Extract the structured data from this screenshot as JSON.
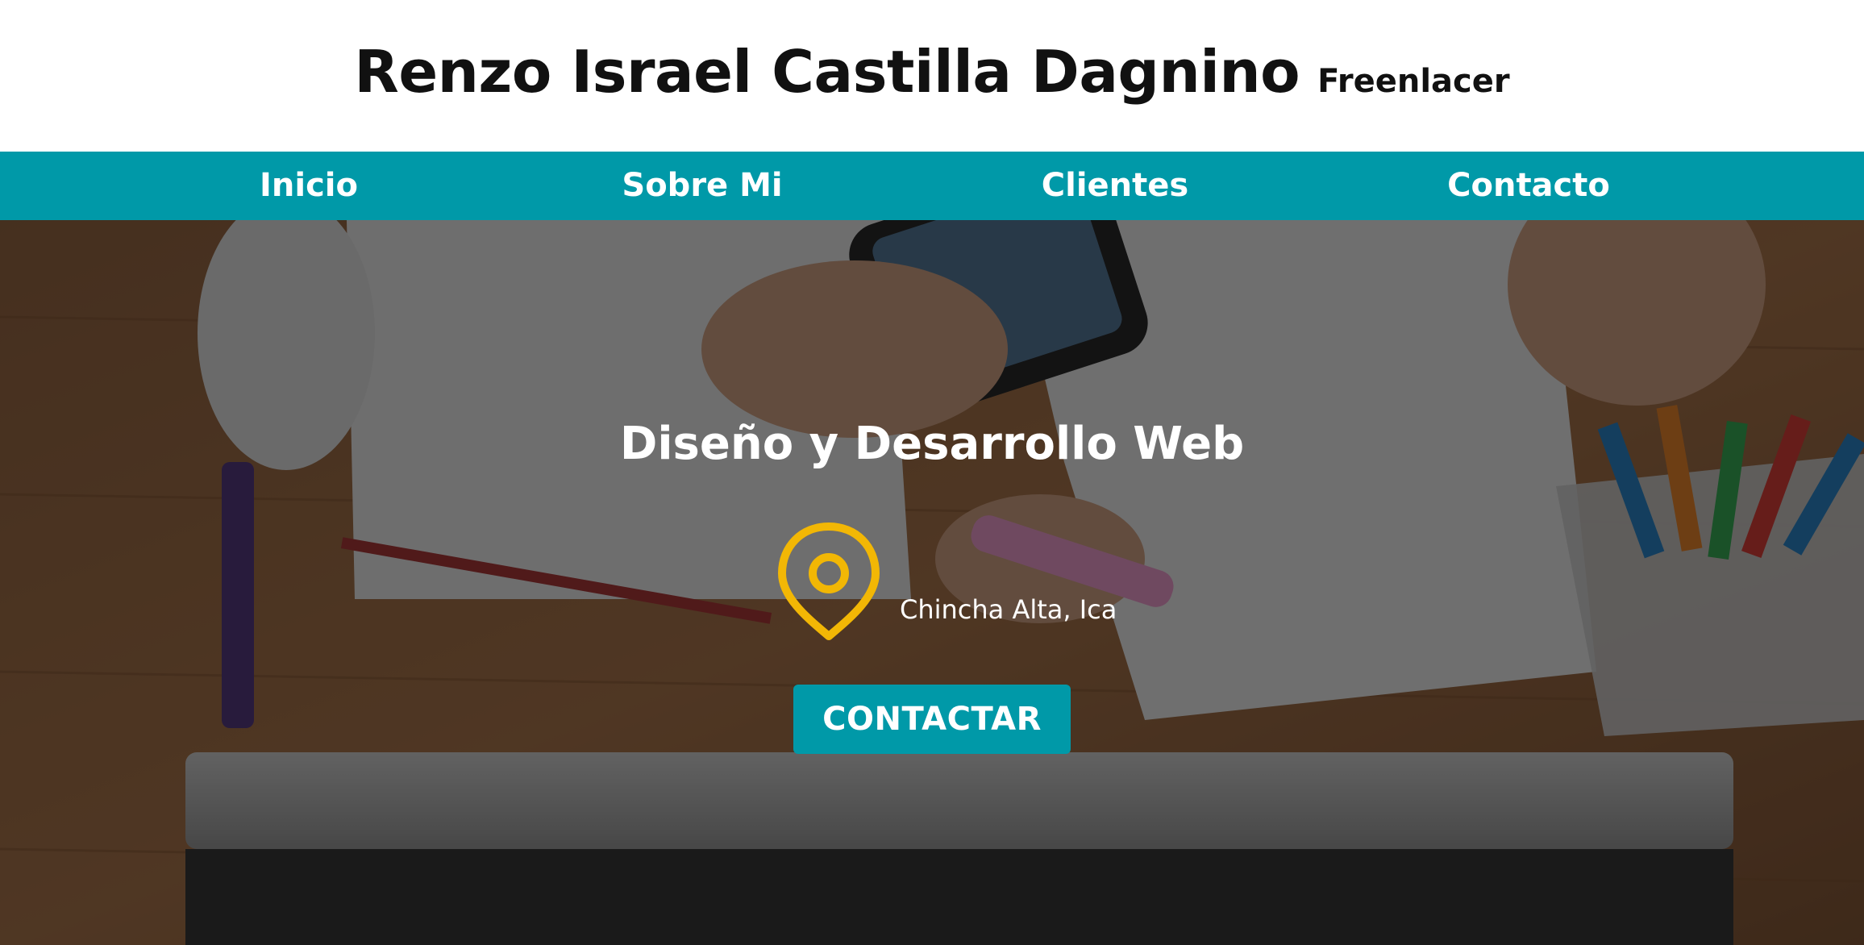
{
  "header": {
    "name": "Renzo Israel Castilla Dagnino",
    "role": "Freenlacer"
  },
  "nav": {
    "items": [
      {
        "label": "Inicio"
      },
      {
        "label": "Sobre Mi"
      },
      {
        "label": "Clientes"
      },
      {
        "label": "Contacto"
      }
    ]
  },
  "hero": {
    "title": "Diseño y Desarrollo Web",
    "location": "Chincha Alta, Ica",
    "location_icon": "location-pin-icon",
    "cta_label": "CONTACTAR",
    "background": "desk-workspace-photo"
  },
  "colors": {
    "accent": "#0099a8",
    "pin": "#f2b705",
    "header_bg": "#ffffff",
    "text_dark": "#111111"
  }
}
